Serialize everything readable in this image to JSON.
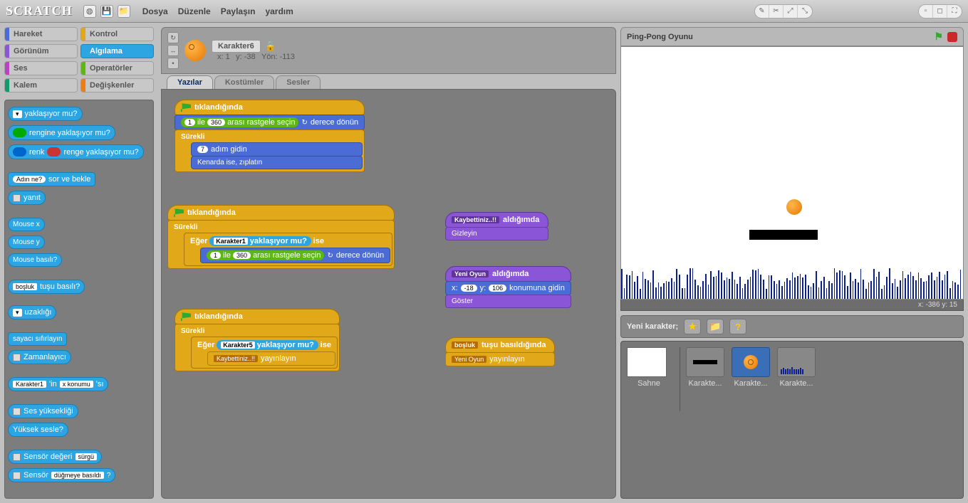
{
  "app": {
    "logo": "SCRATCH"
  },
  "menu": {
    "file": "Dosya",
    "edit": "Düzenle",
    "share": "Paylaşın",
    "help": "yardım"
  },
  "cats": {
    "motion": "Hareket",
    "control": "Kontrol",
    "looks": "Görünüm",
    "sensing": "Algılama",
    "sound": "Ses",
    "operators": "Operatörler",
    "pen": "Kalem",
    "variables": "Değişkenler"
  },
  "palette": {
    "touching": "yaklaşıyor mu?",
    "touchcolor": "rengine yaklaşıyor mu?",
    "colortouch_a": "renk",
    "colortouch_b": "renge yaklaşıyor mu?",
    "ask_a": "Adın ne?",
    "ask_b": "sor ve bekle",
    "answer": "yanıt",
    "mousex": "Mouse x",
    "mousey": "Mouse y",
    "mousedown": "Mouse basılı?",
    "key_a": "boşluk",
    "key_b": "tuşu basılı?",
    "distance": "uzaklığı",
    "resettimer": "sayacı sıfırlayın",
    "timer": "Zamanlayıcı",
    "of_sprite": "Karakter1",
    "of_a": "'in",
    "of_prop": "x konumu",
    "of_b": "'sı",
    "loudness": "Ses yüksekliği",
    "loud": "Yüksek sesle?",
    "sensorval_a": "Sensör değeri",
    "sensorval_b": "sürgü",
    "sensorbool_a": "Sensör",
    "sensorbool_b": "düğmeye basıldı"
  },
  "sprite": {
    "name": "Karakter6",
    "x": "x: 1",
    "y": "y: -38",
    "dir": "Yön: -113"
  },
  "tabs": {
    "scripts": "Yazılar",
    "costumes": "Kostümler",
    "sounds": "Sesler"
  },
  "scr": {
    "whenclicked": "tıklandığında",
    "forever": "Sürekli",
    "if": "Eğer",
    "ise": "ise",
    "pick_a": "ile",
    "pick_b": "arası rastgele seçin",
    "turn": "derece dönün",
    "move_a": "adım gidin",
    "bounce": "Kenarda ise, zıplatın",
    "touching": "yaklaşıyor mu?",
    "char1": "Karakter1",
    "char5": "Karakter5",
    "broadcast": "yayınlayın",
    "lost": "Kaybettiniz..!!",
    "newgame": "Yeni Oyun",
    "receive": "aldığımda",
    "hide": "Gizleyin",
    "show": "Göster",
    "goto_a": "x:",
    "goto_b": "y:",
    "goto_c": "konumuna gidin",
    "keypress_a": "boşluk",
    "keypress_b": "tuşu basıldığında",
    "n1": "1",
    "n360": "360",
    "n7": "7",
    "n_18": "-18",
    "n106": "106"
  },
  "stage": {
    "title": "Ping-Pong Oyunu",
    "coords": "x: -386   y: 15"
  },
  "spr": {
    "new": "Yeni karakter;",
    "s1": "Karakte...",
    "s2": "Karakte...",
    "s3": "Karakte...",
    "stage": "Sahne"
  }
}
